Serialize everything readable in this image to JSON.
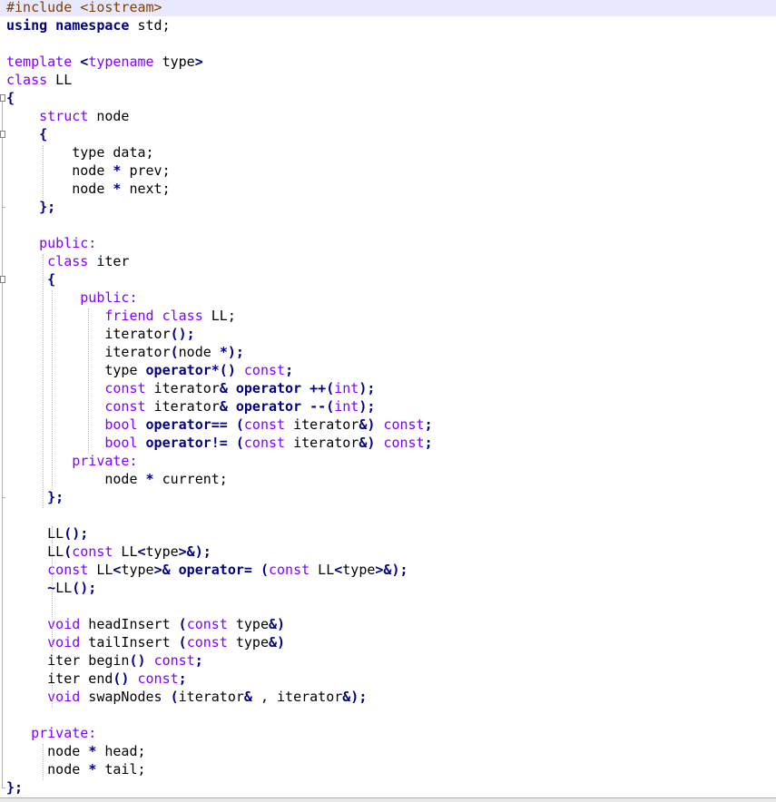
{
  "editor": {
    "language": "C++",
    "current_line_index": 0,
    "colors": {
      "preprocessor": "#804000",
      "keyword": "#8000ff",
      "keyword_bold": "#000080",
      "operator": "#000080",
      "text": "#000000",
      "current_line_bg": "#e8e8ff"
    },
    "lines": [
      [
        {
          "t": "pre",
          "v": "#include <iostream>"
        }
      ],
      [
        {
          "t": "kwb",
          "v": "using namespace"
        },
        {
          "t": "plain",
          "v": " std;"
        }
      ],
      [],
      [
        {
          "t": "kw",
          "v": "template"
        },
        {
          "t": "plain",
          "v": " "
        },
        {
          "t": "op",
          "v": "<"
        },
        {
          "t": "kw",
          "v": "typename"
        },
        {
          "t": "plain",
          "v": " type"
        },
        {
          "t": "op",
          "v": ">"
        }
      ],
      [
        {
          "t": "kw",
          "v": "class"
        },
        {
          "t": "plain",
          "v": " LL"
        }
      ],
      [
        {
          "t": "op",
          "v": "{"
        }
      ],
      [
        {
          "t": "plain",
          "v": "    "
        },
        {
          "t": "kw",
          "v": "struct"
        },
        {
          "t": "plain",
          "v": " node"
        }
      ],
      [
        {
          "t": "plain",
          "v": "    "
        },
        {
          "t": "op",
          "v": "{"
        }
      ],
      [
        {
          "t": "plain",
          "v": "        type data;"
        }
      ],
      [
        {
          "t": "plain",
          "v": "        node "
        },
        {
          "t": "op",
          "v": "*"
        },
        {
          "t": "plain",
          "v": " prev;"
        }
      ],
      [
        {
          "t": "plain",
          "v": "        node "
        },
        {
          "t": "op",
          "v": "*"
        },
        {
          "t": "plain",
          "v": " next;"
        }
      ],
      [
        {
          "t": "plain",
          "v": "    "
        },
        {
          "t": "op",
          "v": "};"
        }
      ],
      [],
      [
        {
          "t": "plain",
          "v": "    "
        },
        {
          "t": "kw",
          "v": "public:"
        }
      ],
      [
        {
          "t": "plain",
          "v": "     "
        },
        {
          "t": "kw",
          "v": "class"
        },
        {
          "t": "plain",
          "v": " iter"
        }
      ],
      [
        {
          "t": "plain",
          "v": "     "
        },
        {
          "t": "op",
          "v": "{"
        }
      ],
      [
        {
          "t": "plain",
          "v": "         "
        },
        {
          "t": "kw",
          "v": "public:"
        }
      ],
      [
        {
          "t": "plain",
          "v": "            "
        },
        {
          "t": "kw",
          "v": "friend class"
        },
        {
          "t": "plain",
          "v": " LL;"
        }
      ],
      [
        {
          "t": "plain",
          "v": "            iterator"
        },
        {
          "t": "op",
          "v": "();"
        }
      ],
      [
        {
          "t": "plain",
          "v": "            iterator"
        },
        {
          "t": "op",
          "v": "("
        },
        {
          "t": "plain",
          "v": "node "
        },
        {
          "t": "op",
          "v": "*);"
        }
      ],
      [
        {
          "t": "plain",
          "v": "            type "
        },
        {
          "t": "op",
          "v": "operator*()"
        },
        {
          "t": "plain",
          "v": " "
        },
        {
          "t": "kw",
          "v": "const"
        },
        {
          "t": "op",
          "v": ";"
        }
      ],
      [
        {
          "t": "plain",
          "v": "            "
        },
        {
          "t": "kw",
          "v": "const"
        },
        {
          "t": "plain",
          "v": " iterator"
        },
        {
          "t": "op",
          "v": "& operator ++("
        },
        {
          "t": "kw",
          "v": "int"
        },
        {
          "t": "op",
          "v": ");"
        }
      ],
      [
        {
          "t": "plain",
          "v": "            "
        },
        {
          "t": "kw",
          "v": "const"
        },
        {
          "t": "plain",
          "v": " iterator"
        },
        {
          "t": "op",
          "v": "& operator --("
        },
        {
          "t": "kw",
          "v": "int"
        },
        {
          "t": "op",
          "v": ");"
        }
      ],
      [
        {
          "t": "plain",
          "v": "            "
        },
        {
          "t": "kw",
          "v": "bool"
        },
        {
          "t": "plain",
          "v": " "
        },
        {
          "t": "op",
          "v": "operator== ("
        },
        {
          "t": "kw",
          "v": "const"
        },
        {
          "t": "plain",
          "v": " iterator"
        },
        {
          "t": "op",
          "v": "&)"
        },
        {
          "t": "plain",
          "v": " "
        },
        {
          "t": "kw",
          "v": "const"
        },
        {
          "t": "op",
          "v": ";"
        }
      ],
      [
        {
          "t": "plain",
          "v": "            "
        },
        {
          "t": "kw",
          "v": "bool"
        },
        {
          "t": "plain",
          "v": " "
        },
        {
          "t": "op",
          "v": "operator!= ("
        },
        {
          "t": "kw",
          "v": "const"
        },
        {
          "t": "plain",
          "v": " iterator"
        },
        {
          "t": "op",
          "v": "&)"
        },
        {
          "t": "plain",
          "v": " "
        },
        {
          "t": "kw",
          "v": "const"
        },
        {
          "t": "op",
          "v": ";"
        }
      ],
      [
        {
          "t": "plain",
          "v": "        "
        },
        {
          "t": "kw",
          "v": "private:"
        }
      ],
      [
        {
          "t": "plain",
          "v": "            node "
        },
        {
          "t": "op",
          "v": "*"
        },
        {
          "t": "plain",
          "v": " current;"
        }
      ],
      [
        {
          "t": "plain",
          "v": "     "
        },
        {
          "t": "op",
          "v": "};"
        }
      ],
      [],
      [
        {
          "t": "plain",
          "v": "     LL"
        },
        {
          "t": "op",
          "v": "();"
        }
      ],
      [
        {
          "t": "plain",
          "v": "     LL"
        },
        {
          "t": "op",
          "v": "("
        },
        {
          "t": "kw",
          "v": "const"
        },
        {
          "t": "plain",
          "v": " LL"
        },
        {
          "t": "op",
          "v": "<"
        },
        {
          "t": "plain",
          "v": "type"
        },
        {
          "t": "op",
          "v": ">&);"
        }
      ],
      [
        {
          "t": "plain",
          "v": "     "
        },
        {
          "t": "kw",
          "v": "const"
        },
        {
          "t": "plain",
          "v": " LL"
        },
        {
          "t": "op",
          "v": "<"
        },
        {
          "t": "plain",
          "v": "type"
        },
        {
          "t": "op",
          "v": ">& operator="
        },
        {
          "t": "plain",
          "v": " "
        },
        {
          "t": "op",
          "v": "("
        },
        {
          "t": "kw",
          "v": "const"
        },
        {
          "t": "plain",
          "v": " LL"
        },
        {
          "t": "op",
          "v": "<"
        },
        {
          "t": "plain",
          "v": "type"
        },
        {
          "t": "op",
          "v": ">&);"
        }
      ],
      [
        {
          "t": "plain",
          "v": "     "
        },
        {
          "t": "op",
          "v": "~"
        },
        {
          "t": "plain",
          "v": "LL"
        },
        {
          "t": "op",
          "v": "();"
        }
      ],
      [],
      [
        {
          "t": "plain",
          "v": "     "
        },
        {
          "t": "kw",
          "v": "void"
        },
        {
          "t": "plain",
          "v": " headInsert "
        },
        {
          "t": "op",
          "v": "("
        },
        {
          "t": "kw",
          "v": "const"
        },
        {
          "t": "plain",
          "v": " type"
        },
        {
          "t": "op",
          "v": "&)"
        }
      ],
      [
        {
          "t": "plain",
          "v": "     "
        },
        {
          "t": "kw",
          "v": "void"
        },
        {
          "t": "plain",
          "v": " tailInsert "
        },
        {
          "t": "op",
          "v": "("
        },
        {
          "t": "kw",
          "v": "const"
        },
        {
          "t": "plain",
          "v": " type"
        },
        {
          "t": "op",
          "v": "&)"
        }
      ],
      [
        {
          "t": "plain",
          "v": "     iter begin"
        },
        {
          "t": "op",
          "v": "()"
        },
        {
          "t": "plain",
          "v": " "
        },
        {
          "t": "kw",
          "v": "const"
        },
        {
          "t": "op",
          "v": ";"
        }
      ],
      [
        {
          "t": "plain",
          "v": "     iter end"
        },
        {
          "t": "op",
          "v": "()"
        },
        {
          "t": "plain",
          "v": " "
        },
        {
          "t": "kw",
          "v": "const"
        },
        {
          "t": "op",
          "v": ";"
        }
      ],
      [
        {
          "t": "plain",
          "v": "     "
        },
        {
          "t": "kw",
          "v": "void"
        },
        {
          "t": "plain",
          "v": " swapNodes "
        },
        {
          "t": "op",
          "v": "("
        },
        {
          "t": "plain",
          "v": "iterator"
        },
        {
          "t": "op",
          "v": "&"
        },
        {
          "t": "plain",
          "v": " , iterator"
        },
        {
          "t": "op",
          "v": "&);"
        }
      ],
      [],
      [
        {
          "t": "plain",
          "v": "   "
        },
        {
          "t": "kw",
          "v": "private:"
        }
      ],
      [
        {
          "t": "plain",
          "v": "     node "
        },
        {
          "t": "op",
          "v": "*"
        },
        {
          "t": "plain",
          "v": " head;"
        }
      ],
      [
        {
          "t": "plain",
          "v": "     node "
        },
        {
          "t": "op",
          "v": "*"
        },
        {
          "t": "plain",
          "v": " tail;"
        }
      ],
      [
        {
          "t": "op",
          "v": "};"
        }
      ]
    ]
  }
}
